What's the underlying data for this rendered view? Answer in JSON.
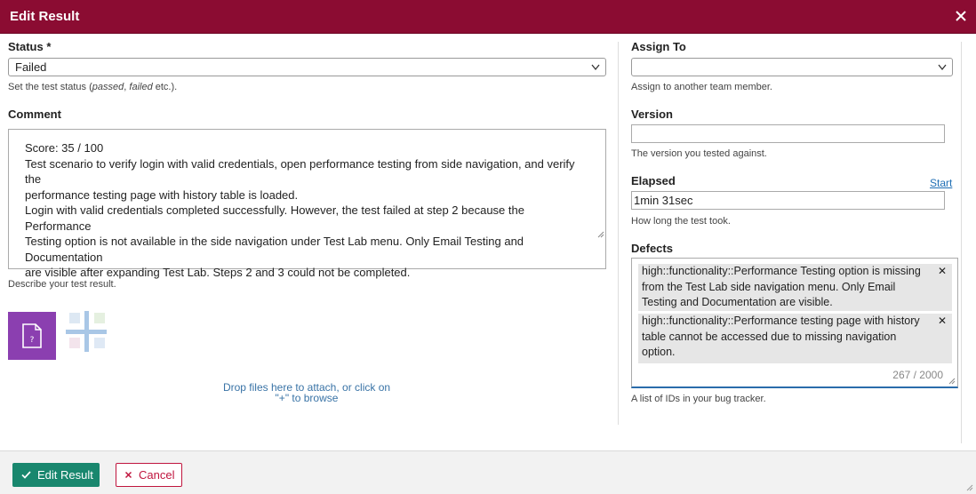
{
  "dialog": {
    "title": "Edit Result"
  },
  "status": {
    "label": "Status *",
    "value": "Failed",
    "hint_prefix": "Set the test status (",
    "hint_passed": "passed",
    "hint_sep": ", ",
    "hint_failed": "failed",
    "hint_suffix": " etc.)."
  },
  "comment": {
    "label": "Comment",
    "lines": [
      "Score: 35 / 100",
      "Test scenario to verify login with valid credentials, open performance testing from side navigation, and verify the",
      "performance testing page with history table is loaded.",
      "Login with valid credentials completed successfully. However, the test failed at step 2 because the Performance",
      "Testing option is not available in the side navigation under Test Lab menu. Only Email Testing and Documentation",
      "are visible after expanding Test Lab. Steps 2 and 3 could not be completed."
    ],
    "hint": "Describe your test result."
  },
  "attachments": {
    "drop_line1": "Drop files here to attach, or click on",
    "drop_line2": "\"+\" to browse"
  },
  "assign_to": {
    "label": "Assign To",
    "value": "",
    "hint": "Assign to another team member."
  },
  "version": {
    "label": "Version",
    "value": "",
    "hint": "The version you tested against."
  },
  "elapsed": {
    "label": "Elapsed",
    "start_link": "Start",
    "value": "1min 31sec",
    "hint": "How long the test took."
  },
  "defects": {
    "label": "Defects",
    "items": [
      {
        "lines": [
          "high::functionality::Performance Testing option is missing",
          "from the Test Lab side navigation menu. Only Email",
          "Testing and Documentation are visible."
        ]
      },
      {
        "lines": [
          "high::functionality::Performance testing page with history",
          "table cannot be accessed due to missing navigation",
          "option."
        ]
      }
    ],
    "counter": "267 / 2000",
    "hint": "A list of IDs in your bug tracker."
  },
  "footer": {
    "submit_label": "Edit Result",
    "cancel_label": "Cancel"
  },
  "colors": {
    "titlebar": "#8b0c32",
    "primary": "#19876e",
    "danger": "#c0153e",
    "link": "#1f6fb5"
  },
  "icons": [
    "close-icon",
    "chevron-down-icon",
    "file-icon",
    "add-attachment-icon",
    "check-icon",
    "x-icon",
    "resize-grip-icon"
  ]
}
